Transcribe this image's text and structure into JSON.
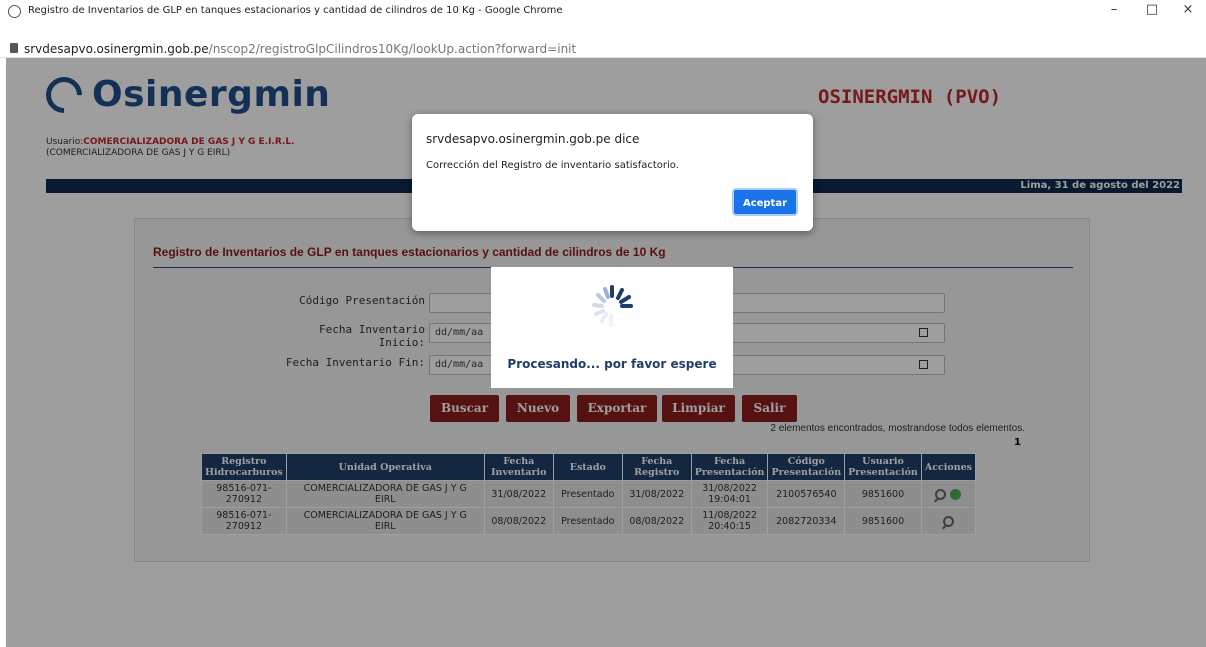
{
  "window": {
    "title": "Registro de Inventarios de GLP en tanques estacionarios y cantidad de cilindros de 10 Kg - Google Chrome",
    "url_host": "srvdesapvo.osinergmin.gob.pe",
    "url_path": "/nscop2/registroGlpCilindros10Kg/lookUp.action?forward=init",
    "controls": [
      "–",
      "□",
      "×"
    ]
  },
  "header": {
    "logo_text": "Osinergmin",
    "system_title": "OSINERGMIN (PVO)",
    "user_label": "Usuario:",
    "user_name": "COMERCIALIZADORA DE GAS J Y G E.I.R.L.",
    "user_sub": "(COMERCIALIZADORA DE GAS J Y G EIRL)",
    "date": "Lima, 31 de agosto del 2022"
  },
  "form": {
    "title": "Registro de Inventarios de GLP en tanques estacionarios y cantidad de cilindros de 10 Kg",
    "fields": [
      {
        "label": "Código Presentación",
        "value": ""
      },
      {
        "label": "Fecha Inventario Inicio:",
        "placeholder": "dd/mm/aa"
      },
      {
        "label": "Fecha Inventario Fin:",
        "placeholder": "dd/mm/aa"
      }
    ],
    "buttons": [
      "Buscar",
      "Nuevo",
      "Exportar",
      "Limpiar",
      "Salir"
    ],
    "count_text": "2 elementos encontrados, mostrandose todos elementos.",
    "page": "1"
  },
  "table": {
    "headers": [
      [
        "Registro",
        "Hidrocarburos"
      ],
      [
        "Unidad Operativa"
      ],
      [
        "Fecha",
        "Inventario"
      ],
      [
        "Estado"
      ],
      [
        "Fecha",
        "Registro"
      ],
      [
        "Fecha",
        "Presentación"
      ],
      [
        "Código",
        "Presentación"
      ],
      [
        "Usuario",
        "Presentación"
      ],
      [
        "Acciones"
      ]
    ],
    "rows": [
      {
        "registro": [
          "98516-071-",
          "270912"
        ],
        "unidad": [
          "COMERCIALIZADORA DE GAS J Y G",
          "EIRL"
        ],
        "fecha_inv": "31/08/2022",
        "estado": "Presentado",
        "fecha_reg": "31/08/2022",
        "fecha_pres": [
          "31/08/2022",
          "19:04:01"
        ],
        "codigo": "2100576540",
        "usuario": "9851600"
      },
      {
        "registro": [
          "98516-071-",
          "270912"
        ],
        "unidad": [
          "COMERCIALIZADORA DE GAS J Y G",
          "EIRL"
        ],
        "fecha_inv": "08/08/2022",
        "estado": "Presentado",
        "fecha_reg": "08/08/2022",
        "fecha_pres": [
          "11/08/2022",
          "20:40:15"
        ],
        "codigo": "2082720334",
        "usuario": "9851600"
      }
    ]
  },
  "processing": {
    "text": "Procesando... por favor espere"
  },
  "alert": {
    "title": "srvdesapvo.osinergmin.gob.pe dice",
    "message": "Corrección del Registro de inventario satisfactorio.",
    "ok_label": "Aceptar"
  },
  "colors": {
    "brand_blue": "#1f4e8c",
    "brand_red": "#c0282d",
    "button_red": "#8c1c1c",
    "dialog_blue": "#1a73e8"
  }
}
